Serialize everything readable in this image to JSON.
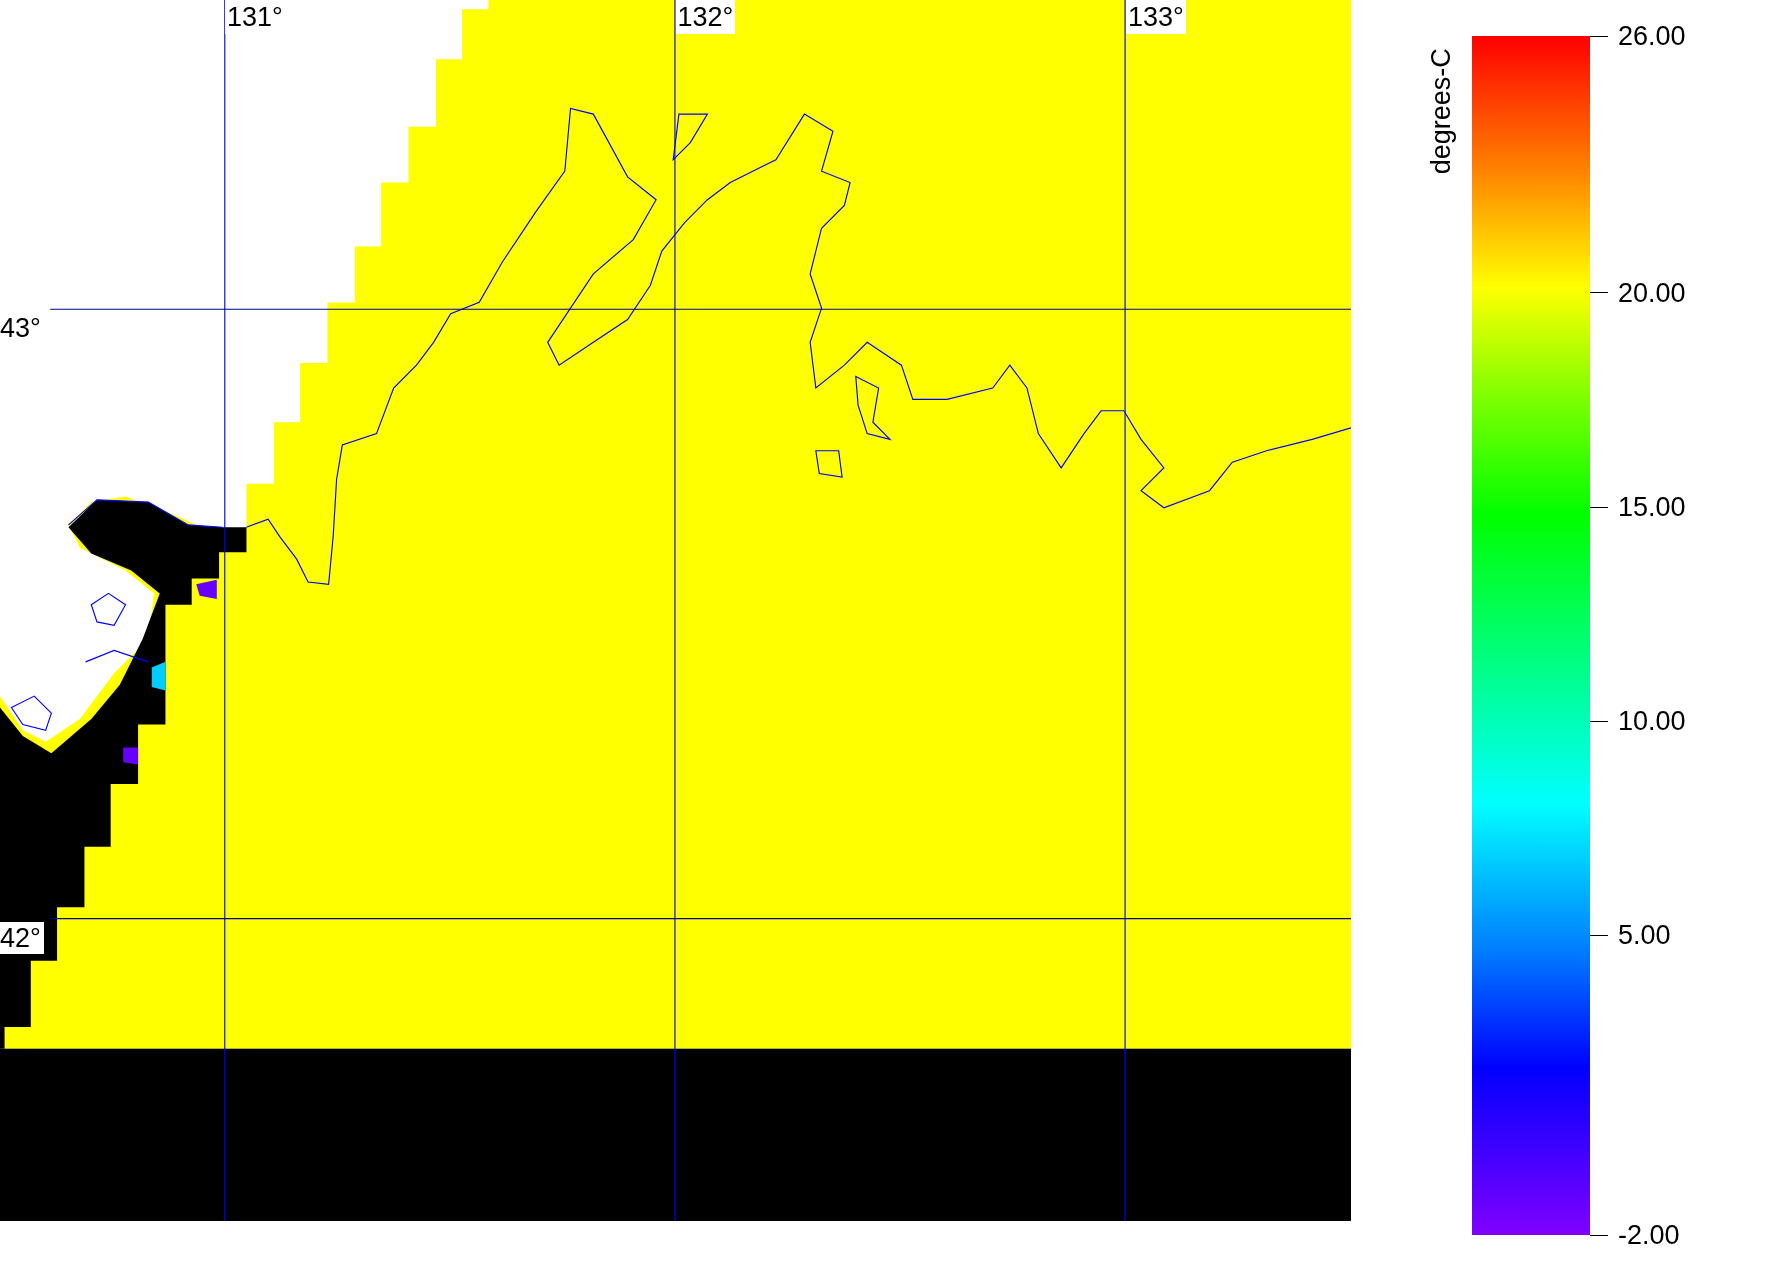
{
  "map": {
    "longitude_labels": [
      "131°",
      "132°",
      "133°"
    ],
    "latitude_labels": [
      "43°",
      "42°"
    ]
  },
  "colorbar": {
    "title": "degrees-C",
    "tick_labels": [
      "26.00",
      "20.00",
      "15.00",
      "10.00",
      "5.00",
      "-2.00"
    ]
  }
}
